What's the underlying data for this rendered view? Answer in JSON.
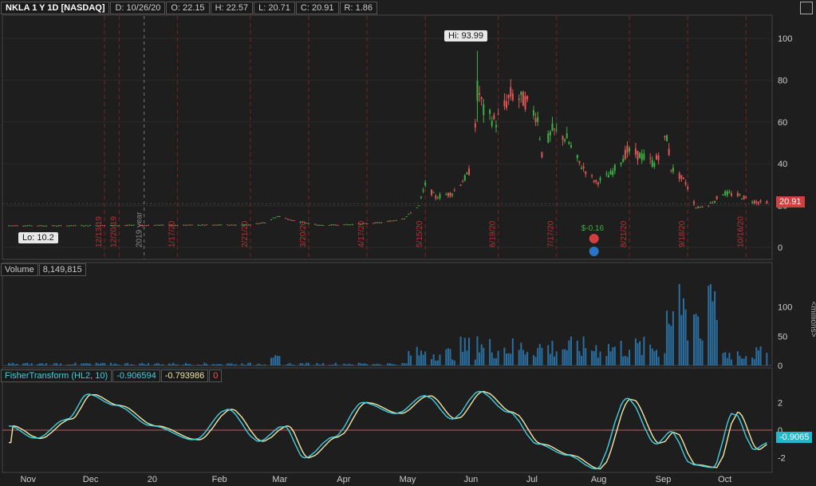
{
  "header": {
    "symbol": "NKLA 1 Y 1D [NASDAQ]",
    "date": "D: 10/26/20",
    "open": "O: 22.15",
    "high": "H: 22.57",
    "low": "L: 20.71",
    "close": "C: 20.91",
    "range": "R: 1.86"
  },
  "price_panel": {
    "hi_callout": "Hi: 93.99",
    "lo_callout": "Lo: 10.2",
    "last_price": "20.91",
    "y_ticks": [
      "100",
      "80",
      "60",
      "40",
      "20",
      "0"
    ],
    "event_labels": [
      "12/13/19",
      "12/20/19",
      "1/17/20",
      "2/21/20",
      "3/20/20",
      "4/17/20",
      "5/15/20",
      "6/19/20",
      "7/17/20",
      "8/21/20",
      "9/18/20",
      "10/16/20"
    ],
    "year_label": "2019 year",
    "earnings_label": "$-0.16"
  },
  "volume_panel": {
    "title": "Volume",
    "value": "8,149,815",
    "y_ticks": [
      "100",
      "50",
      "0"
    ],
    "unit_label": "<millions>"
  },
  "fisher_panel": {
    "title": "FisherTransform (HL2, 10)",
    "value1": "-0.906594",
    "value2": "-0.793986",
    "value3": "0",
    "y_ticks": [
      "2",
      "0",
      "-2"
    ],
    "last_value": "-0.9065"
  },
  "x_axis": [
    "Nov",
    "Dec",
    "20",
    "Feb",
    "Mar",
    "Apr",
    "May",
    "Jun",
    "Jul",
    "Aug",
    "Sep",
    "Oct"
  ],
  "colors": {
    "bg": "#1e1e1e",
    "up": "#3cb043",
    "down": "#e05555",
    "grid_dash": "#7a2222",
    "fisher": "#3fd0e0",
    "trigger": "#f0e6a8",
    "volume": "#2b6fa0"
  },
  "chart_data": {
    "type": "line",
    "title": "NKLA 1 Y 1D [NASDAQ]",
    "price_key_points": [
      {
        "date": "2019-11",
        "close": 10.5
      },
      {
        "date": "2020-01",
        "close": 10.6
      },
      {
        "date": "2020-03",
        "close": 14
      },
      {
        "date": "2020-04",
        "close": 10.8
      },
      {
        "date": "2020-05-15",
        "close": 30
      },
      {
        "date": "2020-06-05",
        "close": 36
      },
      {
        "date": "2020-06-09",
        "close": 79.73
      },
      {
        "date": "2020-06-10",
        "high": 93.99
      },
      {
        "date": "2020-06-25",
        "close": 72
      },
      {
        "date": "2020-07-20",
        "close": 50
      },
      {
        "date": "2020-08-05",
        "close": 31
      },
      {
        "date": "2020-08-20",
        "close": 46
      },
      {
        "date": "2020-09-08",
        "close": 50
      },
      {
        "date": "2020-09-22",
        "close": 19
      },
      {
        "date": "2020-10-26",
        "close": 20.91
      }
    ],
    "low": 10.2,
    "high": 93.99,
    "last_close": 20.91,
    "ylim": [
      0,
      100
    ],
    "volume_ylim": [
      0,
      150
    ],
    "fisher_ylim": [
      -3,
      3
    ]
  }
}
